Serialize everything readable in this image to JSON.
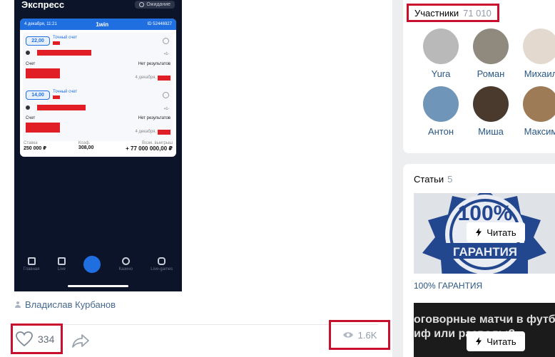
{
  "post": {
    "phone": {
      "title": "Экспресс",
      "status": "Ожидание",
      "ticket": {
        "date": "4 декабря, 11:21",
        "brand": "1win",
        "id": "ID 52446927",
        "bets": [
          {
            "odd": "22,00",
            "type": "Точный счет",
            "score_label": "Счет",
            "result": "Нет результатов",
            "date": "4 декабря,"
          },
          {
            "odd": "14,00",
            "type": "Точный счет",
            "score_label": "Счет",
            "result": "Нет результатов",
            "date": "4 декабря,"
          }
        ],
        "stake_label": "Ставка",
        "stake_value": "250 000 ₽",
        "coef_label": "Коэф.",
        "coef_value": "308,00",
        "win_label": "Возм. выигрыш",
        "win_value": "+ 77 000 000,00 ₽"
      },
      "tabs": [
        "Главная",
        "Live",
        "",
        "Казино",
        "Live-games"
      ]
    },
    "author": "Владислав Курбанов",
    "likes": "334",
    "views": "1.6K"
  },
  "members": {
    "label": "Участники",
    "count": "71 010",
    "people": [
      {
        "name": "Yura",
        "color": "#b9b9b9"
      },
      {
        "name": "Роман",
        "color": "#8f8a7d"
      },
      {
        "name": "Михаил",
        "color": "#e3d9cf"
      },
      {
        "name": "Антон",
        "color": "#6f95b8"
      },
      {
        "name": "Миша",
        "color": "#4a3a2e"
      },
      {
        "name": "Максим",
        "color": "#9c7b56"
      }
    ]
  },
  "articles": {
    "label": "Статьи",
    "count": "5",
    "items": [
      {
        "read": "Читать",
        "caption": "100% ГАРАНТИЯ",
        "badge": "100%",
        "banner": "ГАРАНТИЯ"
      },
      {
        "read": "Читать",
        "overlay": "оговорные матчи в футб",
        "overlay2": "иф или разводы?"
      }
    ]
  },
  "colors": {
    "highlight": "#c8102e",
    "link": "#2a5885",
    "accent": "#1f6fe0"
  }
}
